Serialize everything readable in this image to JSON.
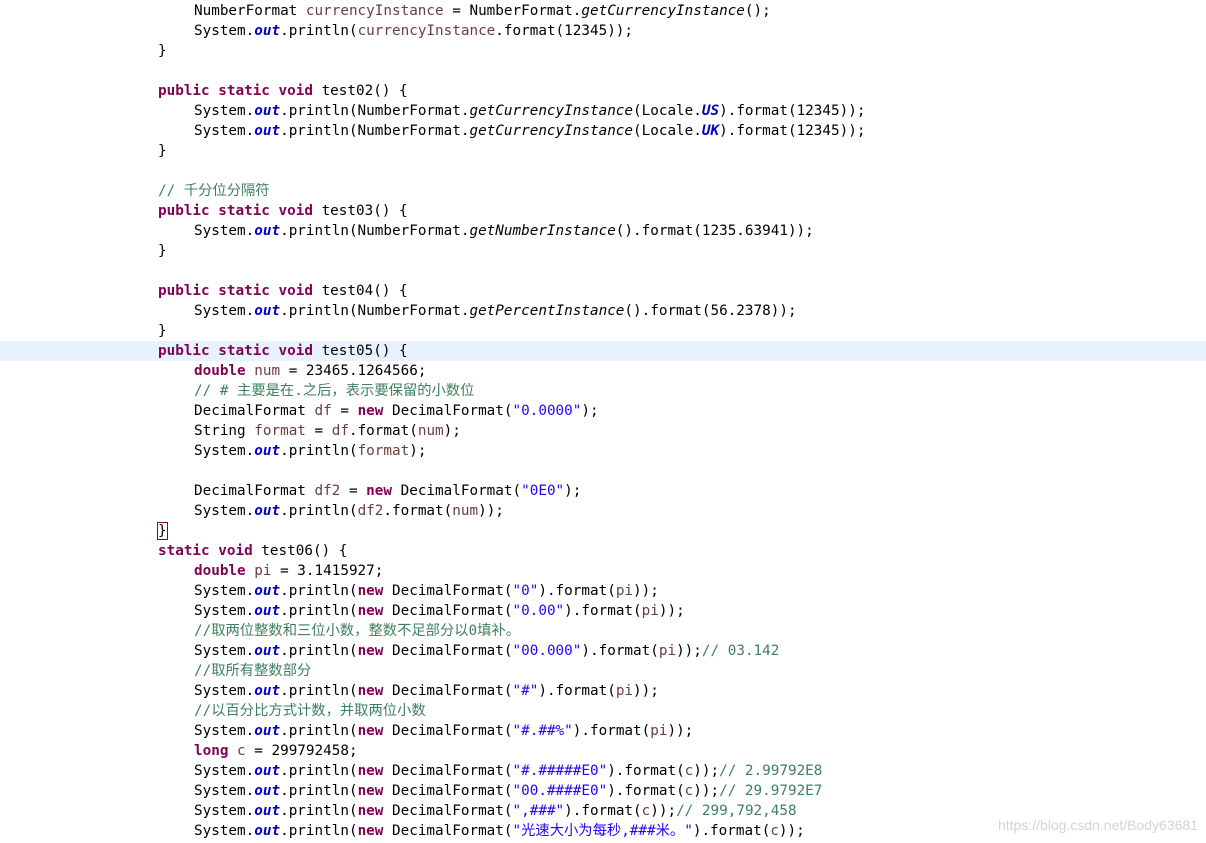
{
  "colors": {
    "background": "#ffffff",
    "current_line": "#e8f2fe",
    "keyword": "#7f0055",
    "static_field": "#0000c0",
    "local_variable": "#6a3e3e",
    "string": "#2a00ff",
    "comment": "#3f7f5f"
  },
  "editor": {
    "current_line_index": 17,
    "lines": [
      {
        "indent": 1,
        "tokens": [
          [
            "plain",
            "NumberFormat "
          ],
          [
            "var",
            "currencyInstance"
          ],
          [
            "plain",
            " = NumberFormat."
          ],
          [
            "method",
            "getCurrencyInstance"
          ],
          [
            "plain",
            "();"
          ]
        ]
      },
      {
        "indent": 1,
        "tokens": [
          [
            "plain",
            "System."
          ],
          [
            "field",
            "out"
          ],
          [
            "plain",
            ".println("
          ],
          [
            "var",
            "currencyInstance"
          ],
          [
            "plain",
            ".format(12345));"
          ]
        ]
      },
      {
        "indent": 0,
        "tokens": [
          [
            "plain",
            "}"
          ]
        ]
      },
      {
        "indent": 0,
        "tokens": []
      },
      {
        "indent": 0,
        "tokens": [
          [
            "kw",
            "public"
          ],
          [
            "plain",
            " "
          ],
          [
            "kw",
            "static"
          ],
          [
            "plain",
            " "
          ],
          [
            "kw",
            "void"
          ],
          [
            "plain",
            " test02() {"
          ]
        ]
      },
      {
        "indent": 1,
        "tokens": [
          [
            "plain",
            "System."
          ],
          [
            "field",
            "out"
          ],
          [
            "plain",
            ".println(NumberFormat."
          ],
          [
            "method",
            "getCurrencyInstance"
          ],
          [
            "plain",
            "(Locale."
          ],
          [
            "field",
            "US"
          ],
          [
            "plain",
            ").format(12345));"
          ]
        ]
      },
      {
        "indent": 1,
        "tokens": [
          [
            "plain",
            "System."
          ],
          [
            "field",
            "out"
          ],
          [
            "plain",
            ".println(NumberFormat."
          ],
          [
            "method",
            "getCurrencyInstance"
          ],
          [
            "plain",
            "(Locale."
          ],
          [
            "field",
            "UK"
          ],
          [
            "plain",
            ").format(12345));"
          ]
        ]
      },
      {
        "indent": 0,
        "tokens": [
          [
            "plain",
            "}"
          ]
        ]
      },
      {
        "indent": 0,
        "tokens": []
      },
      {
        "indent": 0,
        "tokens": [
          [
            "comment",
            "// 千分位分隔符"
          ]
        ]
      },
      {
        "indent": 0,
        "tokens": [
          [
            "kw",
            "public"
          ],
          [
            "plain",
            " "
          ],
          [
            "kw",
            "static"
          ],
          [
            "plain",
            " "
          ],
          [
            "kw",
            "void"
          ],
          [
            "plain",
            " test03() {"
          ]
        ]
      },
      {
        "indent": 1,
        "tokens": [
          [
            "plain",
            "System."
          ],
          [
            "field",
            "out"
          ],
          [
            "plain",
            ".println(NumberFormat."
          ],
          [
            "method",
            "getNumberInstance"
          ],
          [
            "plain",
            "().format(1235.63941));"
          ]
        ]
      },
      {
        "indent": 0,
        "tokens": [
          [
            "plain",
            "}"
          ]
        ]
      },
      {
        "indent": 0,
        "tokens": []
      },
      {
        "indent": 0,
        "tokens": [
          [
            "kw",
            "public"
          ],
          [
            "plain",
            " "
          ],
          [
            "kw",
            "static"
          ],
          [
            "plain",
            " "
          ],
          [
            "kw",
            "void"
          ],
          [
            "plain",
            " test04() {"
          ]
        ]
      },
      {
        "indent": 1,
        "tokens": [
          [
            "plain",
            "System."
          ],
          [
            "field",
            "out"
          ],
          [
            "plain",
            ".println(NumberFormat."
          ],
          [
            "method",
            "getPercentInstance"
          ],
          [
            "plain",
            "().format(56.2378));"
          ]
        ]
      },
      {
        "indent": 0,
        "tokens": [
          [
            "plain",
            "}"
          ]
        ]
      },
      {
        "indent": 0,
        "tokens": [
          [
            "kw",
            "public"
          ],
          [
            "plain",
            " "
          ],
          [
            "kw",
            "static"
          ],
          [
            "plain",
            " "
          ],
          [
            "kw",
            "void"
          ],
          [
            "plain",
            " test05() {"
          ]
        ]
      },
      {
        "indent": 1,
        "tokens": [
          [
            "kw",
            "double"
          ],
          [
            "plain",
            " "
          ],
          [
            "var",
            "num"
          ],
          [
            "plain",
            " = 23465.1264566;"
          ]
        ]
      },
      {
        "indent": 1,
        "tokens": [
          [
            "comment",
            "// # 主要是在.之后，表示要保留的小数位"
          ]
        ]
      },
      {
        "indent": 1,
        "tokens": [
          [
            "plain",
            "DecimalFormat "
          ],
          [
            "var",
            "df"
          ],
          [
            "plain",
            " = "
          ],
          [
            "kw",
            "new"
          ],
          [
            "plain",
            " DecimalFormat("
          ],
          [
            "str",
            "\"0.0000\""
          ],
          [
            "plain",
            ");"
          ]
        ]
      },
      {
        "indent": 1,
        "tokens": [
          [
            "plain",
            "String "
          ],
          [
            "var",
            "format"
          ],
          [
            "plain",
            " = "
          ],
          [
            "var",
            "df"
          ],
          [
            "plain",
            ".format("
          ],
          [
            "var",
            "num"
          ],
          [
            "plain",
            ");"
          ]
        ]
      },
      {
        "indent": 1,
        "tokens": [
          [
            "plain",
            "System."
          ],
          [
            "field",
            "out"
          ],
          [
            "plain",
            ".println("
          ],
          [
            "var",
            "format"
          ],
          [
            "plain",
            ");"
          ]
        ]
      },
      {
        "indent": 0,
        "tokens": []
      },
      {
        "indent": 1,
        "tokens": [
          [
            "plain",
            "DecimalFormat "
          ],
          [
            "var",
            "df2"
          ],
          [
            "plain",
            " = "
          ],
          [
            "kw",
            "new"
          ],
          [
            "plain",
            " DecimalFormat("
          ],
          [
            "str",
            "\"0E0\""
          ],
          [
            "plain",
            ");"
          ]
        ]
      },
      {
        "indent": 1,
        "tokens": [
          [
            "plain",
            "System."
          ],
          [
            "field",
            "out"
          ],
          [
            "plain",
            ".println("
          ],
          [
            "var",
            "df2"
          ],
          [
            "plain",
            ".format("
          ],
          [
            "var",
            "num"
          ],
          [
            "plain",
            "));"
          ]
        ]
      },
      {
        "indent": 0,
        "tokens": [
          [
            "cursor",
            "}"
          ]
        ]
      },
      {
        "indent": 0,
        "tokens": [
          [
            "kw",
            "static"
          ],
          [
            "plain",
            " "
          ],
          [
            "kw",
            "void"
          ],
          [
            "plain",
            " test06() {"
          ]
        ]
      },
      {
        "indent": 1,
        "tokens": [
          [
            "kw",
            "double"
          ],
          [
            "plain",
            " "
          ],
          [
            "var",
            "pi"
          ],
          [
            "plain",
            " = 3.1415927;"
          ]
        ]
      },
      {
        "indent": 1,
        "tokens": [
          [
            "plain",
            "System."
          ],
          [
            "field",
            "out"
          ],
          [
            "plain",
            ".println("
          ],
          [
            "kw",
            "new"
          ],
          [
            "plain",
            " DecimalFormat("
          ],
          [
            "str",
            "\"0\""
          ],
          [
            "plain",
            ").format("
          ],
          [
            "var",
            "pi"
          ],
          [
            "plain",
            "));"
          ]
        ]
      },
      {
        "indent": 1,
        "tokens": [
          [
            "plain",
            "System."
          ],
          [
            "field",
            "out"
          ],
          [
            "plain",
            ".println("
          ],
          [
            "kw",
            "new"
          ],
          [
            "plain",
            " DecimalFormat("
          ],
          [
            "str",
            "\"0.00\""
          ],
          [
            "plain",
            ").format("
          ],
          [
            "var",
            "pi"
          ],
          [
            "plain",
            "));"
          ]
        ]
      },
      {
        "indent": 1,
        "tokens": [
          [
            "comment",
            "//取两位整数和三位小数，整数不足部分以0填补。"
          ]
        ]
      },
      {
        "indent": 1,
        "tokens": [
          [
            "plain",
            "System."
          ],
          [
            "field",
            "out"
          ],
          [
            "plain",
            ".println("
          ],
          [
            "kw",
            "new"
          ],
          [
            "plain",
            " DecimalFormat("
          ],
          [
            "str",
            "\"00.000\""
          ],
          [
            "plain",
            ").format("
          ],
          [
            "var",
            "pi"
          ],
          [
            "plain",
            "));"
          ],
          [
            "comment",
            "// 03.142"
          ]
        ]
      },
      {
        "indent": 1,
        "tokens": [
          [
            "comment",
            "//取所有整数部分"
          ]
        ]
      },
      {
        "indent": 1,
        "tokens": [
          [
            "plain",
            "System."
          ],
          [
            "field",
            "out"
          ],
          [
            "plain",
            ".println("
          ],
          [
            "kw",
            "new"
          ],
          [
            "plain",
            " DecimalFormat("
          ],
          [
            "str",
            "\"#\""
          ],
          [
            "plain",
            ").format("
          ],
          [
            "var",
            "pi"
          ],
          [
            "plain",
            "));"
          ]
        ]
      },
      {
        "indent": 1,
        "tokens": [
          [
            "comment",
            "//以百分比方式计数，并取两位小数"
          ]
        ]
      },
      {
        "indent": 1,
        "tokens": [
          [
            "plain",
            "System."
          ],
          [
            "field",
            "out"
          ],
          [
            "plain",
            ".println("
          ],
          [
            "kw",
            "new"
          ],
          [
            "plain",
            " DecimalFormat("
          ],
          [
            "str",
            "\"#.##%\""
          ],
          [
            "plain",
            ").format("
          ],
          [
            "var",
            "pi"
          ],
          [
            "plain",
            "));"
          ]
        ]
      },
      {
        "indent": 1,
        "tokens": [
          [
            "kw",
            "long"
          ],
          [
            "plain",
            " "
          ],
          [
            "var",
            "c"
          ],
          [
            "plain",
            " = 299792458;"
          ]
        ]
      },
      {
        "indent": 1,
        "tokens": [
          [
            "plain",
            "System."
          ],
          [
            "field",
            "out"
          ],
          [
            "plain",
            ".println("
          ],
          [
            "kw",
            "new"
          ],
          [
            "plain",
            " DecimalFormat("
          ],
          [
            "str",
            "\"#.#####E0\""
          ],
          [
            "plain",
            ").format("
          ],
          [
            "var",
            "c"
          ],
          [
            "plain",
            "));"
          ],
          [
            "comment",
            "// 2.99792E8"
          ]
        ]
      },
      {
        "indent": 1,
        "tokens": [
          [
            "plain",
            "System."
          ],
          [
            "field",
            "out"
          ],
          [
            "plain",
            ".println("
          ],
          [
            "kw",
            "new"
          ],
          [
            "plain",
            " DecimalFormat("
          ],
          [
            "str",
            "\"00.####E0\""
          ],
          [
            "plain",
            ").format("
          ],
          [
            "var",
            "c"
          ],
          [
            "plain",
            "));"
          ],
          [
            "comment",
            "// 29.9792E7"
          ]
        ]
      },
      {
        "indent": 1,
        "tokens": [
          [
            "plain",
            "System."
          ],
          [
            "field",
            "out"
          ],
          [
            "plain",
            ".println("
          ],
          [
            "kw",
            "new"
          ],
          [
            "plain",
            " DecimalFormat("
          ],
          [
            "str",
            "\",###\""
          ],
          [
            "plain",
            ").format("
          ],
          [
            "var",
            "c"
          ],
          [
            "plain",
            "));"
          ],
          [
            "comment",
            "// 299,792,458"
          ]
        ]
      },
      {
        "indent": 1,
        "tokens": [
          [
            "plain",
            "System."
          ],
          [
            "field",
            "out"
          ],
          [
            "plain",
            ".println("
          ],
          [
            "kw",
            "new"
          ],
          [
            "plain",
            " DecimalFormat("
          ],
          [
            "str",
            "\"光速大小为每秒,###米。\""
          ],
          [
            "plain",
            ").format("
          ],
          [
            "var",
            "c"
          ],
          [
            "plain",
            "));"
          ]
        ]
      }
    ]
  },
  "watermark": "https://blog.csdn.net/Body63681"
}
